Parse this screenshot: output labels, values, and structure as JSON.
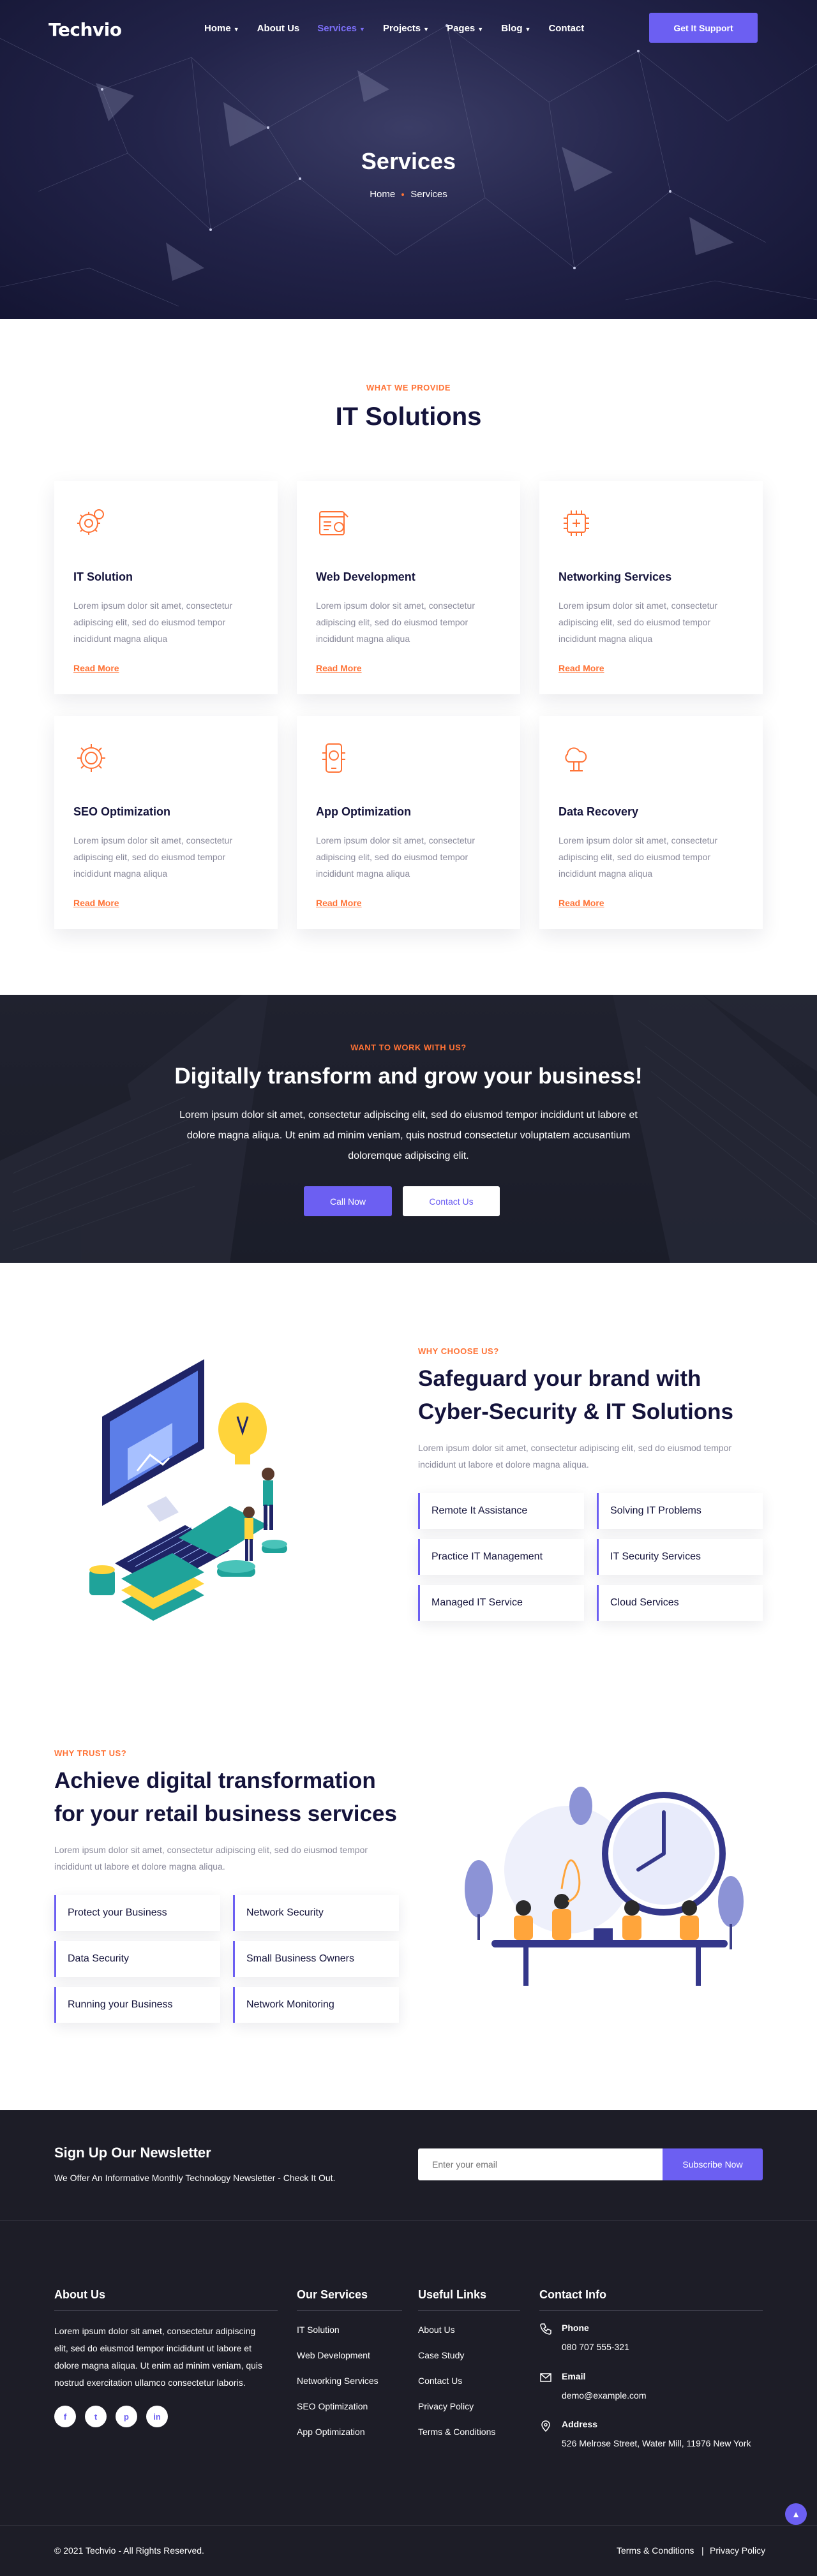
{
  "nav": {
    "logo": "Techvio",
    "items": [
      "Home",
      "About Us",
      "Services",
      "Projects",
      "Pages",
      "Blog",
      "Contact"
    ],
    "support": "Get It Support"
  },
  "hero": {
    "title": "Services",
    "crumb_home": "Home",
    "crumb_current": "Services"
  },
  "services": {
    "eyebrow": "WHAT WE PROVIDE",
    "title": "IT Solutions",
    "read_more": "Read More",
    "desc": "Lorem ipsum dolor sit amet, consectetur adipiscing elit, sed do eiusmod tempor incididunt magna aliqua",
    "cards": [
      {
        "title": "IT Solution",
        "icon": "gear-icon"
      },
      {
        "title": "Web Development",
        "icon": "web-icon"
      },
      {
        "title": "Networking Services",
        "icon": "chip-icon"
      },
      {
        "title": "SEO Optimization",
        "icon": "seo-gear-icon"
      },
      {
        "title": "App Optimization",
        "icon": "phone-icon"
      },
      {
        "title": "Data Recovery",
        "icon": "data-icon"
      }
    ]
  },
  "cta": {
    "eyebrow": "WANT TO WORK WITH US?",
    "title": "Digitally transform and grow your business!",
    "text": "Lorem ipsum dolor sit amet, consectetur adipiscing elit, sed do eiusmod tempor incididunt ut labore et dolore magna aliqua. Ut enim ad minim veniam, quis nostrud consectetur voluptatem accusantium doloremque adipiscing elit.",
    "call": "Call Now",
    "contact": "Contact Us"
  },
  "why": {
    "eyebrow": "WHY CHOOSE US?",
    "title": "Safeguard your brand with Cyber-Security & IT Solutions",
    "text": "Lorem ipsum dolor sit amet, consectetur adipiscing elit, sed do eiusmod tempor incididunt ut labore et dolore magna aliqua.",
    "items": [
      "Remote It Assistance",
      "Solving IT Problems",
      "Practice IT Management",
      "IT Security Services",
      "Managed IT Service",
      "Cloud Services"
    ]
  },
  "trust": {
    "eyebrow": "WHY TRUST US?",
    "title": "Achieve digital transformation for your retail business services",
    "text": "Lorem ipsum dolor sit amet, consectetur adipiscing elit, sed do eiusmod tempor incididunt ut labore et dolore magna aliqua.",
    "items": [
      "Protect your Business",
      "Network Security",
      "Data Security",
      "Small Business Owners",
      "Running your Business",
      "Network Monitoring"
    ]
  },
  "newsletter": {
    "title": "Sign Up Our Newsletter",
    "text": "We Offer An Informative Monthly Technology Newsletter - Check It Out.",
    "placeholder": "Enter your email",
    "button": "Subscribe Now"
  },
  "footer": {
    "about_title": "About Us",
    "about_text": "Lorem ipsum dolor sit amet, consectetur adipiscing elit, sed do eiusmod tempor incididunt ut labore et dolore magna aliqua. Ut enim ad minim veniam, quis nostrud exercitation ullamco consectetur laboris.",
    "services_title": "Our Services",
    "services": [
      "IT Solution",
      "Web Development",
      "Networking Services",
      "SEO Optimization",
      "App Optimization"
    ],
    "links_title": "Useful Links",
    "links": [
      "About Us",
      "Case Study",
      "Contact Us",
      "Privacy Policy",
      "Terms & Conditions"
    ],
    "contact_title": "Contact Info",
    "phone_label": "Phone",
    "phone": "080 707 555-321",
    "email_label": "Email",
    "email": "demo@example.com",
    "address_label": "Address",
    "address": "526 Melrose Street, Water Mill, 11976 New York",
    "copyright": "© 2021 Techvio - All Rights Reserved.",
    "terms": "Terms & Conditions",
    "sep": "|",
    "privacy": "Privacy Policy"
  },
  "colors": {
    "accent": "#6c5ff2",
    "orange": "#ff7235",
    "dark": "#1d1d27"
  }
}
